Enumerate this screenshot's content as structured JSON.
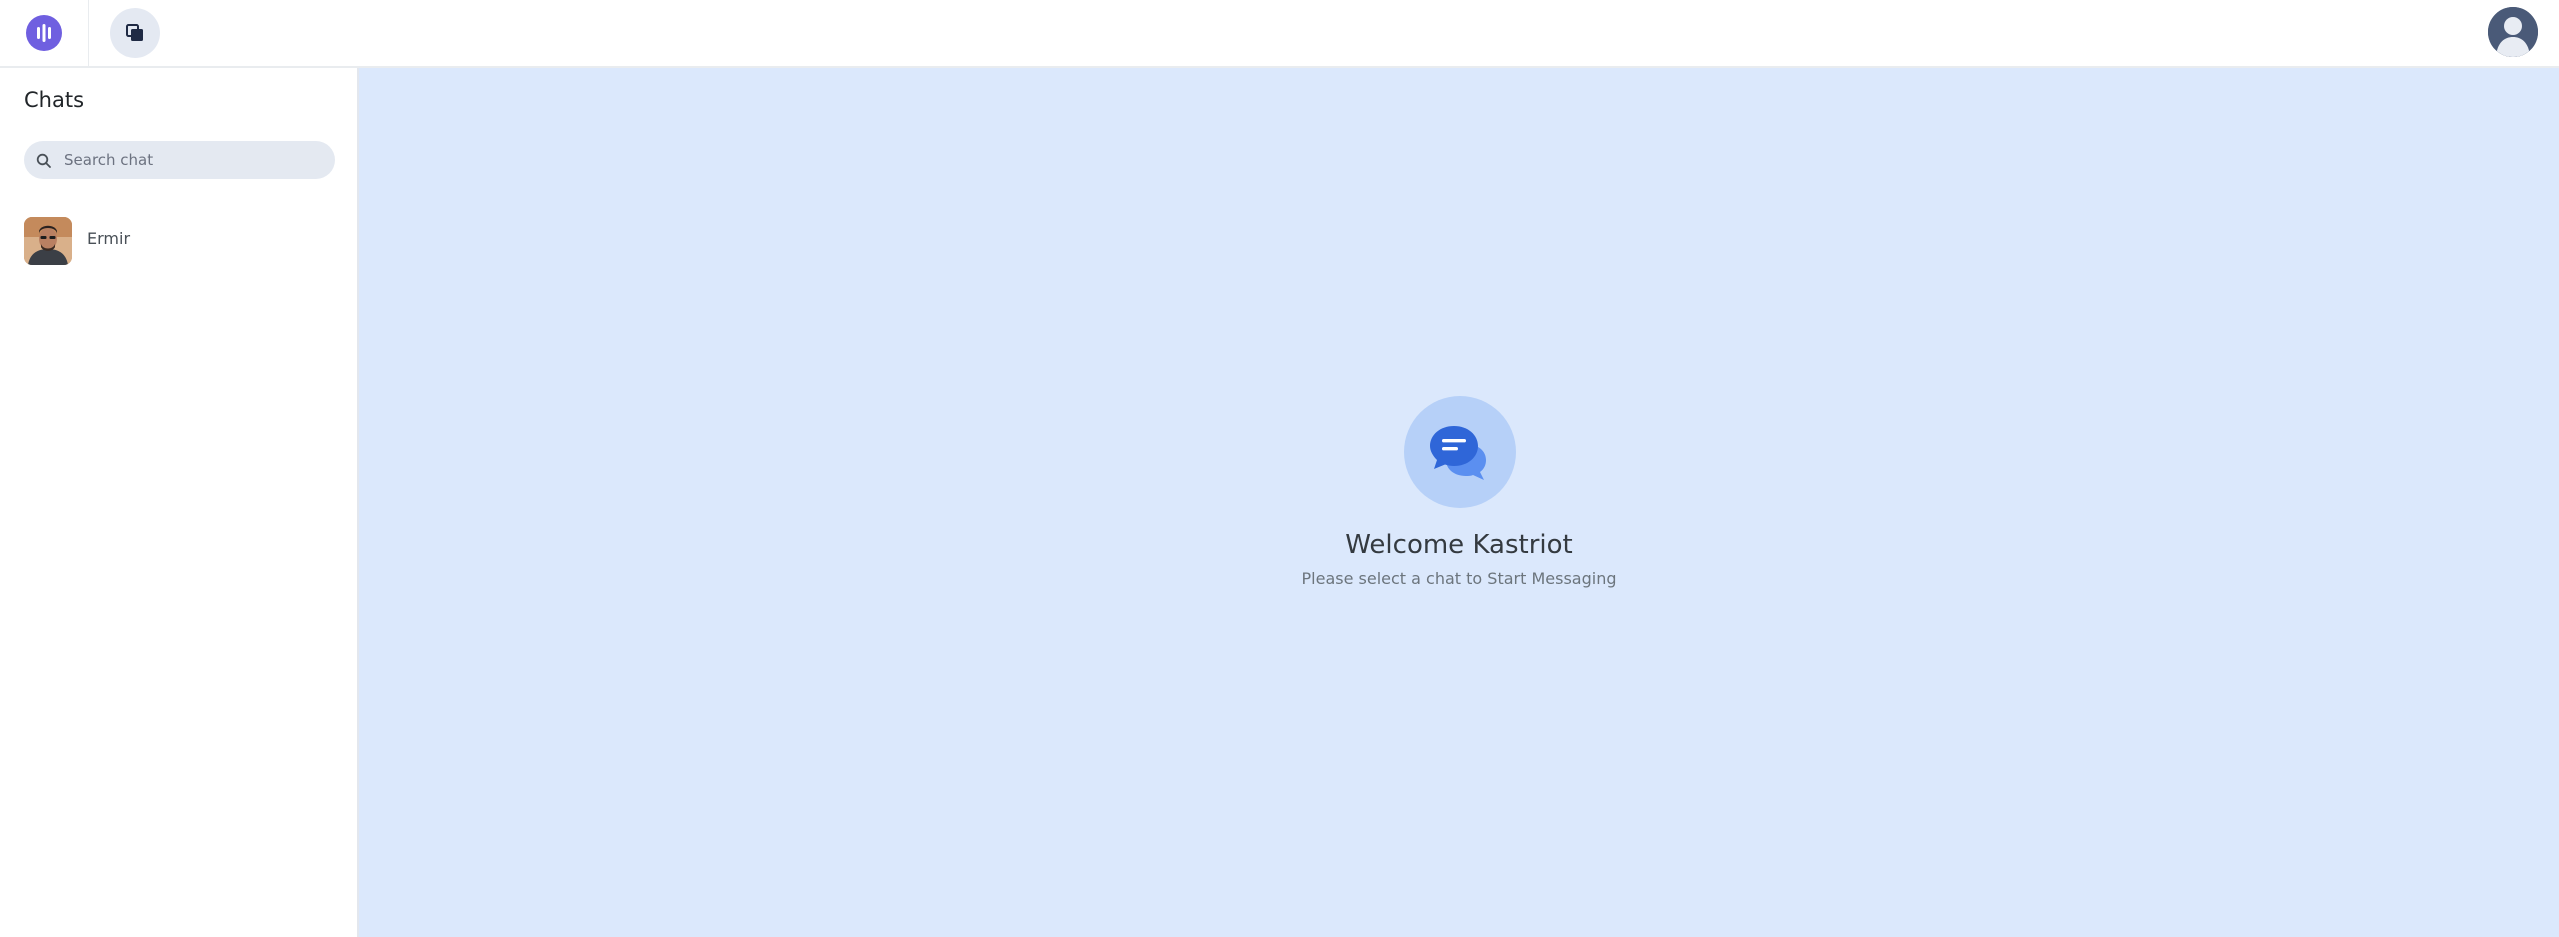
{
  "header": {
    "logo_icon": "waveform-logo-icon",
    "nav_icon": "copy-squares-icon",
    "profile_icon": "user-avatar"
  },
  "sidebar": {
    "title": "Chats",
    "search": {
      "placeholder": "Search chat",
      "value": ""
    },
    "chats": [
      {
        "name": "Ermir"
      }
    ]
  },
  "main": {
    "icon": "chat-bubbles-icon",
    "title": "Welcome Kastriot",
    "subtitle": "Please select a chat to Start Messaging"
  },
  "colors": {
    "accent": "#6f5fe0",
    "main_bg": "#dbe8fc",
    "icon_circle": "#b6d0f8",
    "bubble_primary": "#2f66d8",
    "bubble_secondary": "#5b8ff0"
  }
}
